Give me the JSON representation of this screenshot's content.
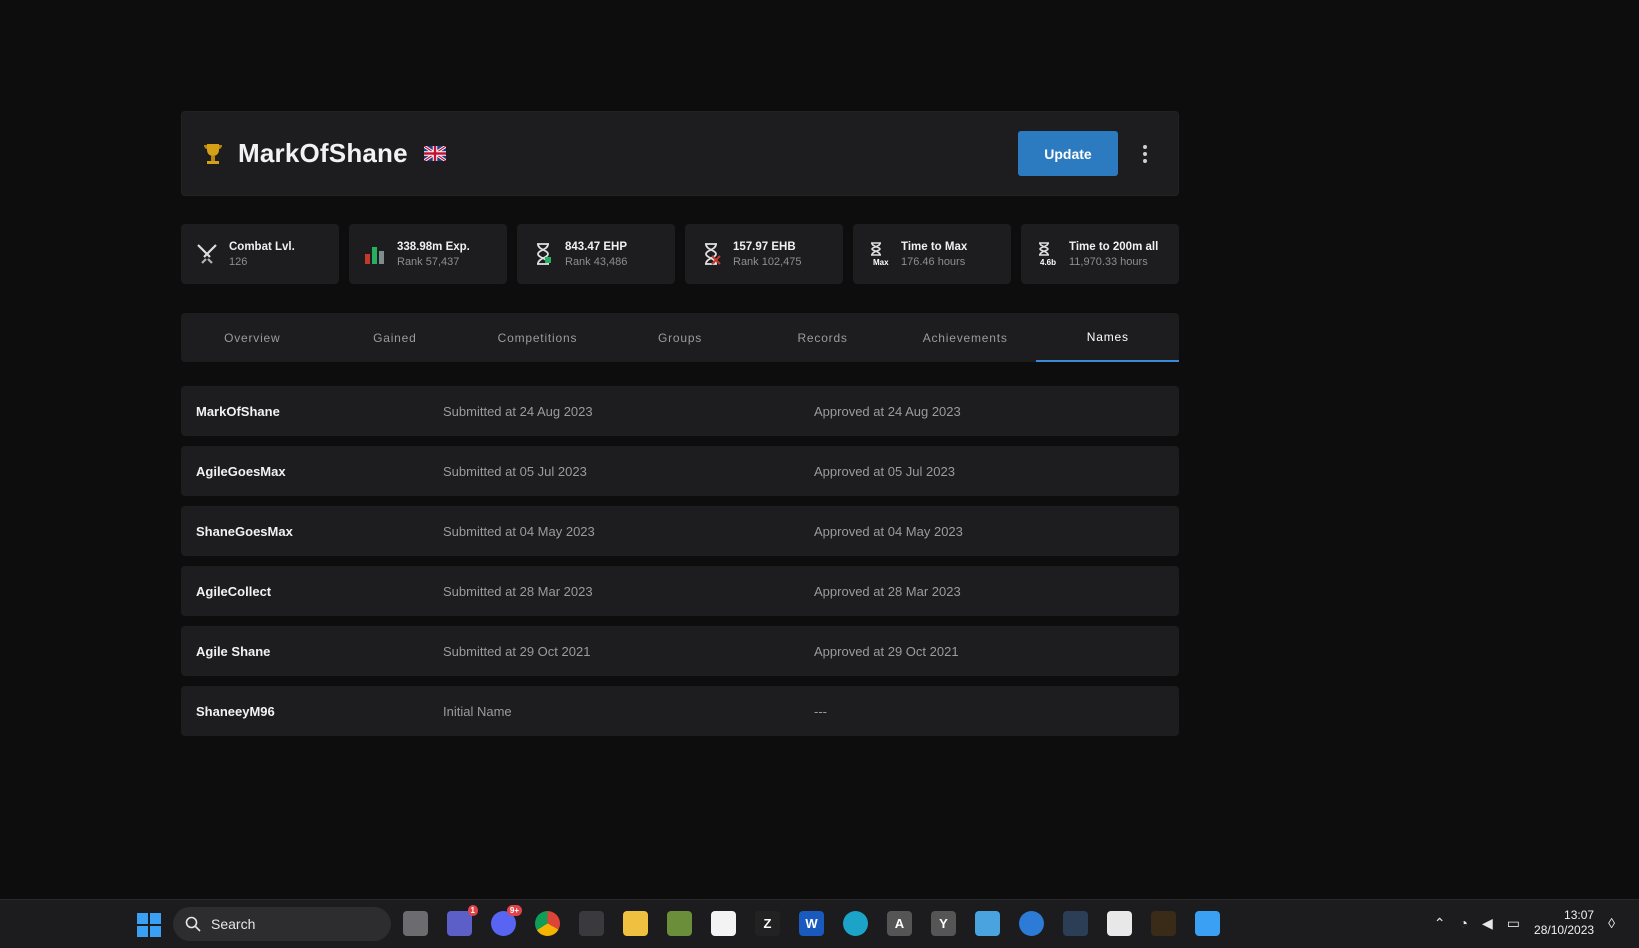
{
  "player": {
    "name": "MarkOfShane",
    "update_label": "Update"
  },
  "stats": [
    {
      "title": "Combat Lvl.",
      "sub": "126",
      "icon": "crossed-swords-icon"
    },
    {
      "title": "338.98m Exp.",
      "sub": "Rank 57,437",
      "icon": "bar-chart-icon"
    },
    {
      "title": "843.47 EHP",
      "sub": "Rank 43,486",
      "icon": "hourglass-icon"
    },
    {
      "title": "157.97 EHB",
      "sub": "Rank 102,475",
      "icon": "hourglass-sword-icon"
    },
    {
      "title": "Time to Max",
      "sub": "176.46 hours",
      "icon": "hourglass-max-icon"
    },
    {
      "title": "Time to 200m all",
      "sub": "11,970.33 hours",
      "icon": "hourglass-4.6b-icon"
    }
  ],
  "tabs": [
    "Overview",
    "Gained",
    "Competitions",
    "Groups",
    "Records",
    "Achievements",
    "Names"
  ],
  "active_tab": "Names",
  "names": [
    {
      "name": "MarkOfShane",
      "submitted": "Submitted at 24 Aug 2023",
      "approved": "Approved at 24 Aug 2023"
    },
    {
      "name": "AgileGoesMax",
      "submitted": "Submitted at 05 Jul 2023",
      "approved": "Approved at 05 Jul 2023"
    },
    {
      "name": "ShaneGoesMax",
      "submitted": "Submitted at 04 May 2023",
      "approved": "Approved at 04 May 2023"
    },
    {
      "name": "AgileCollect",
      "submitted": "Submitted at 28 Mar 2023",
      "approved": "Approved at 28 Mar 2023"
    },
    {
      "name": "Agile Shane",
      "submitted": "Submitted at 29 Oct 2021",
      "approved": "Approved at 29 Oct 2021"
    },
    {
      "name": "ShaneeyM96",
      "submitted": "Initial Name",
      "approved": "---"
    }
  ],
  "taskbar": {
    "search_label": "Search",
    "teams_badge": "1",
    "discord_badge": "9+",
    "time": "13:07",
    "date": "28/10/2023"
  },
  "tiles": {
    "a": "A",
    "y": "Y",
    "z": "Z",
    "w": "W",
    "max": "Max",
    "b46": "4.6b"
  },
  "colors": {
    "background": "#0d0d0e",
    "panel": "#1d1d1f",
    "accent": "#2c7bc0",
    "active_tab_underline": "#3b8ad6",
    "muted_text": "#9a9aa0"
  }
}
